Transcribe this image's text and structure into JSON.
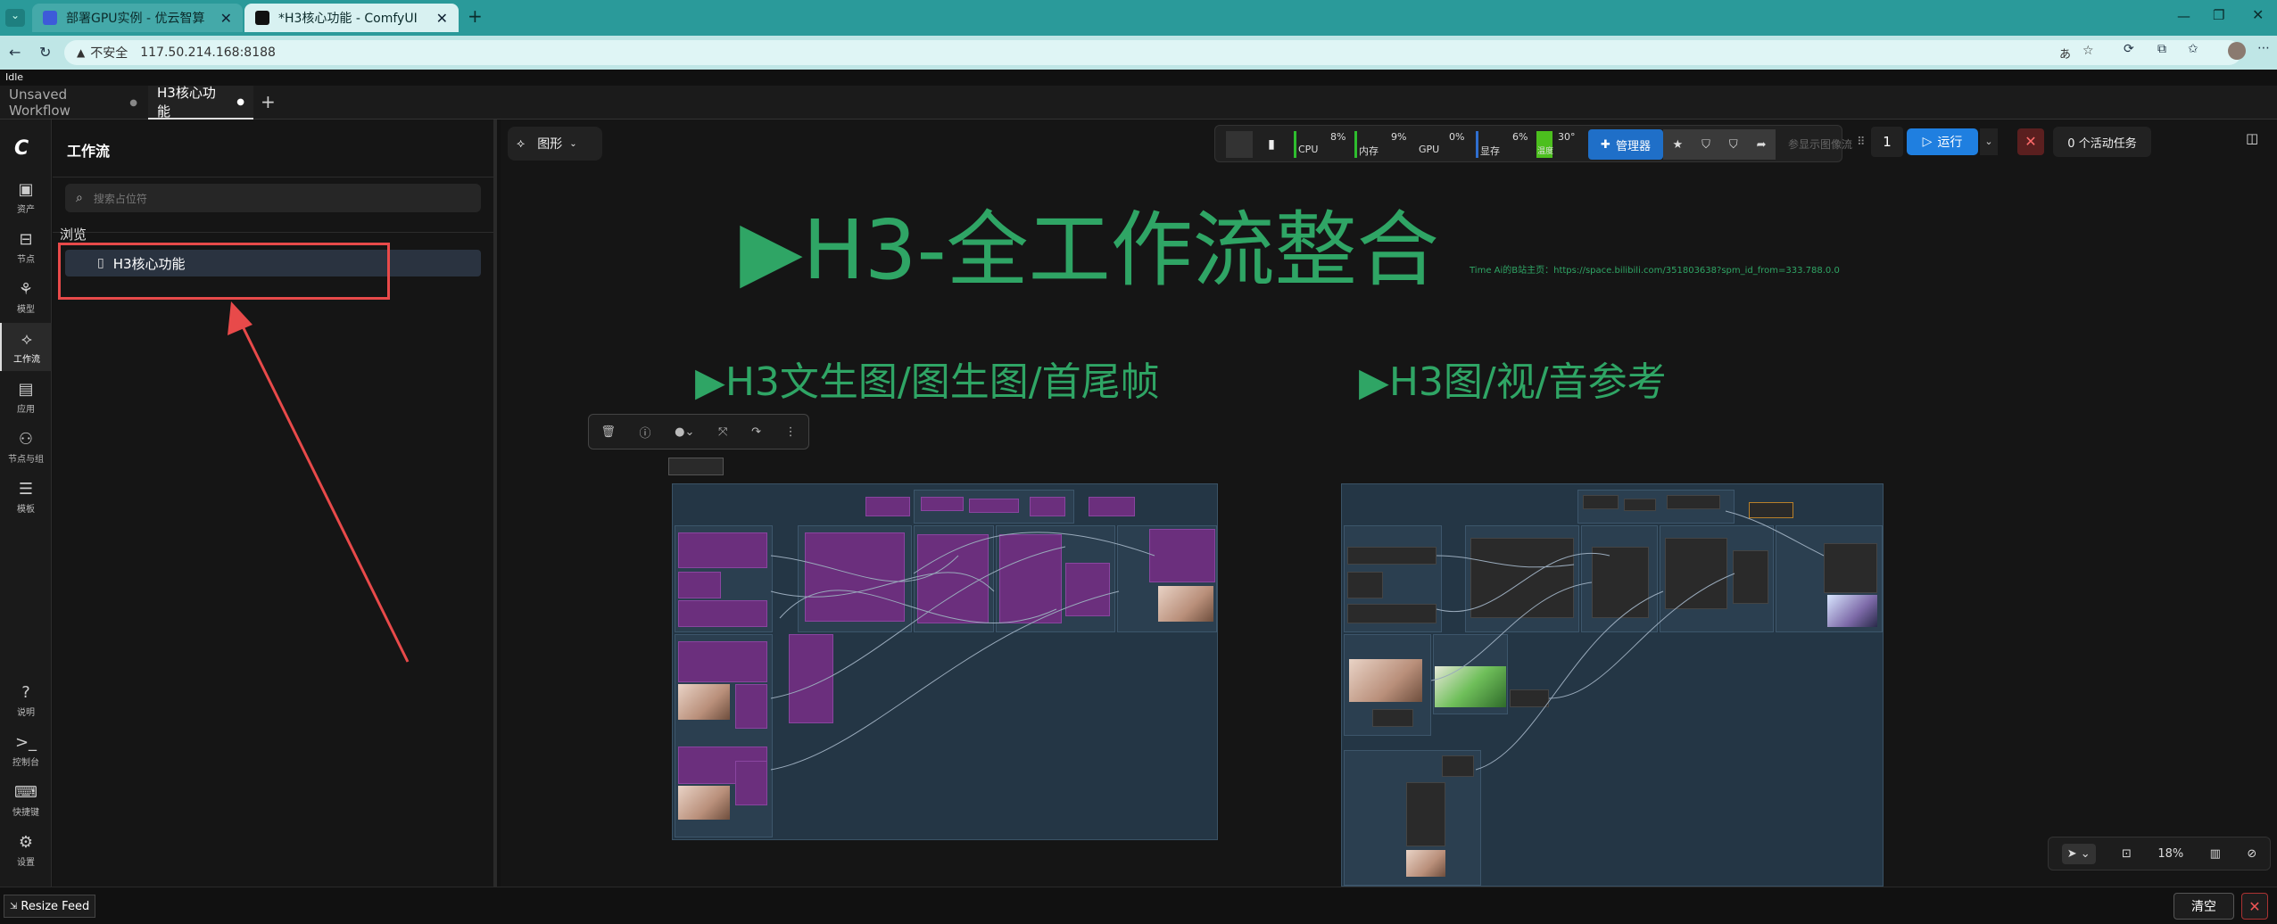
{
  "browser": {
    "tabs": [
      {
        "title": "部署GPU实例 - 优云智算",
        "active": false
      },
      {
        "title": "*H3核心功能 - ComfyUI",
        "active": true
      }
    ],
    "security_label": "不安全",
    "url": "117.50.214.168:8188"
  },
  "status": {
    "idle": "Idle"
  },
  "workflow_tabs": [
    {
      "label": "Unsaved Workflow"
    },
    {
      "label": "H3核心功能"
    }
  ],
  "rail": [
    {
      "label": "资产",
      "icon": "image-icon"
    },
    {
      "label": "节点",
      "icon": "node-icon"
    },
    {
      "label": "模型",
      "icon": "model-icon"
    },
    {
      "label": "工作流",
      "icon": "workflow-icon"
    },
    {
      "label": "应用",
      "icon": "app-icon"
    },
    {
      "label": "节点与组",
      "icon": "graph-icon"
    },
    {
      "label": "模板",
      "icon": "template-icon"
    },
    {
      "label": "说明",
      "icon": "help-icon"
    },
    {
      "label": "控制台",
      "icon": "terminal-icon"
    },
    {
      "label": "快捷键",
      "icon": "keyboard-icon"
    },
    {
      "label": "设置",
      "icon": "gear-icon"
    }
  ],
  "panel": {
    "title": "工作流",
    "search_placeholder": "搜索占位符",
    "section": "浏览",
    "item": "H3核心功能"
  },
  "toolbar": {
    "graph_label": "图形",
    "cpu_pct": "8%",
    "cpu_label": "CPU",
    "mem_pct": "9%",
    "mem_label": "内存",
    "gpu_pct": "0%",
    "gpu_label": "GPU",
    "vram_pct": "6%",
    "vram_label": "显存",
    "temp": "30°",
    "temp_label": "温度",
    "manager": "管理器",
    "image_flow": "参显示图像流",
    "queue_count": "1",
    "run": "运行",
    "active_tasks": "0 个活动任务"
  },
  "canvas": {
    "main_title": "▶H3-全工作流整合",
    "link_text": "Time Ai的B站主页：https://space.bilibili.com/351803638?spm_id_from=333.788.0.0",
    "group_left": "▶H3文生图/图生图/首尾帧",
    "group_right": "▶H3图/视/音参考",
    "zoom": "18%"
  },
  "footer": {
    "resize_feed": "Resize Feed",
    "clear": "清空"
  },
  "colors": {
    "accent_blue": "#1f7fe0",
    "title_green": "#2fa565",
    "browser_teal": "#2a9a9a",
    "highlight_red": "#e84a4a"
  }
}
